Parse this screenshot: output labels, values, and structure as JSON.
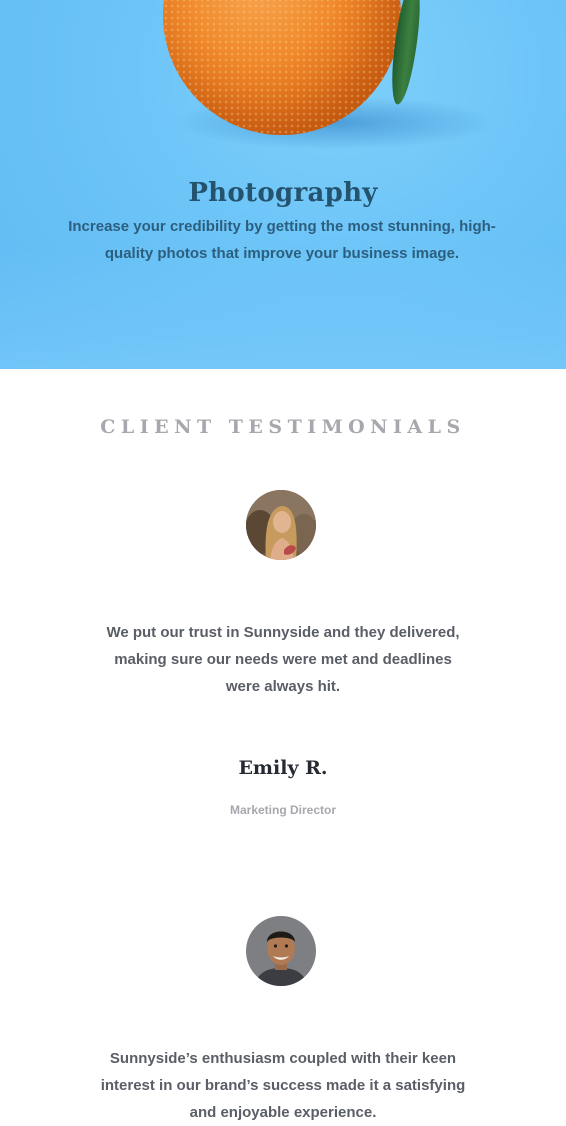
{
  "hero": {
    "title": "Photography",
    "description": "Increase your credibility by getting the most stunning, high-quality photos that improve your business image.",
    "image": "orange-on-blue-photo"
  },
  "testimonials": {
    "heading": "CLIENT TESTIMONIALS",
    "items": [
      {
        "avatar": "woman-portrait-avatar",
        "quote": "We put our trust in Sunnyside and they delivered, making sure our needs were met and deadlines were always hit.",
        "name": "Emily R.",
        "role": "Marketing Director"
      },
      {
        "avatar": "man-portrait-avatar",
        "quote": "Sunnyside’s enthusiasm coupled with their keen interest in our brand’s success made it a satisfying and enjoyable experience."
      }
    ]
  },
  "colors": {
    "hero_background": "#6cc4f7",
    "hero_title": "#24536e",
    "hero_text": "#2c5f7f",
    "heading_gray": "#a6a8ad",
    "quote_text": "#5a5e66",
    "name_text": "#252a33"
  }
}
